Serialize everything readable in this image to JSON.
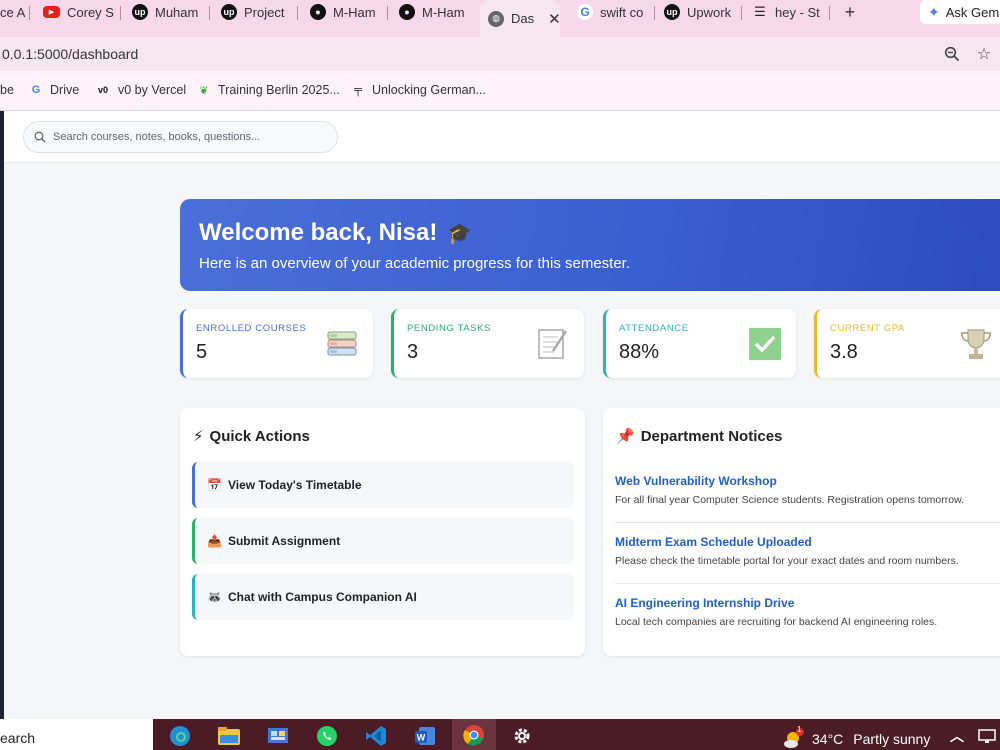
{
  "browser": {
    "tabs": [
      {
        "label": "ce A",
        "icon": "generic-icon"
      },
      {
        "label": "Corey S",
        "icon": "youtube-icon"
      },
      {
        "label": "Muham",
        "icon": "upwork-icon"
      },
      {
        "label": "Project",
        "icon": "upwork-icon"
      },
      {
        "label": "M-Ham",
        "icon": "github-icon"
      },
      {
        "label": "M-Ham",
        "icon": "github-icon"
      },
      {
        "label": "Das",
        "icon": "globe-icon",
        "active": true
      },
      {
        "label": "swift co",
        "icon": "google-icon"
      },
      {
        "label": "Upwork",
        "icon": "upwork-icon"
      },
      {
        "label": "hey - St",
        "icon": "stackoverflow-icon"
      }
    ],
    "ask_gemini": "Ask Gem",
    "url": "0.0.1:5000/dashboard",
    "bookmarks": [
      {
        "label": "be"
      },
      {
        "label": "Drive"
      },
      {
        "label": "v0 by Vercel"
      },
      {
        "label": "Training Berlin 2025..."
      },
      {
        "label": "Unlocking German..."
      }
    ]
  },
  "search": {
    "placeholder": "Search courses, notes, books, questions..."
  },
  "welcome": {
    "title": "Welcome back, Nisa!",
    "subtitle": "Here is an overview of your academic progress for this semester."
  },
  "stats": [
    {
      "label": "Enrolled Courses",
      "value": "5",
      "color": "#4a6fd8",
      "icon": "books-icon"
    },
    {
      "label": "Pending Tasks",
      "value": "3",
      "color": "#2fae6e",
      "icon": "notepad-icon"
    },
    {
      "label": "Attendance",
      "value": "88%",
      "color": "#2bb5b5",
      "icon": "checkmark-icon"
    },
    {
      "label": "Current GPA",
      "value": "3.8",
      "color": "#e8b92e",
      "icon": "trophy-icon"
    }
  ],
  "quick_actions": {
    "title": "Quick Actions",
    "items": [
      {
        "label": "View Today's Timetable",
        "color": "#4a6fd8",
        "icon": "calendar-icon"
      },
      {
        "label": "Submit Assignment",
        "color": "#2fae6e",
        "icon": "upload-icon"
      },
      {
        "label": "Chat with Campus Companion AI",
        "color": "#2bb5b5",
        "icon": "raccoon-icon"
      }
    ]
  },
  "notices": {
    "title": "Department Notices",
    "items": [
      {
        "title": "Web Vulnerability Workshop",
        "desc": "For all final year Computer Science students. Registration opens tomorrow."
      },
      {
        "title": "Midterm Exam Schedule Uploaded",
        "desc": "Please check the timetable portal for your exact dates and room numbers."
      },
      {
        "title": "AI Engineering Internship Drive",
        "desc": "Local tech companies are recruiting for backend AI engineering roles."
      }
    ]
  },
  "taskbar": {
    "search_label": "earch",
    "weather_temp": "34°C",
    "weather_desc": "Partly sunny",
    "weather_badge": "1"
  }
}
